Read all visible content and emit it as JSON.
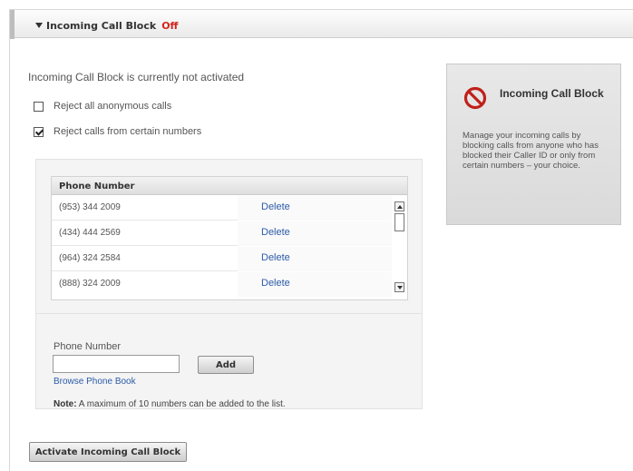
{
  "header": {
    "title": "Incoming Call Block",
    "status": "Off"
  },
  "status_text": "Incoming Call Block is currently not activated",
  "options": [
    {
      "label": "Reject all anonymous calls",
      "checked": false
    },
    {
      "label": "Reject calls from certain numbers",
      "checked": true
    }
  ],
  "table": {
    "column_header": "Phone Number",
    "rows": [
      {
        "number": "(953) 344 2009",
        "action": "Delete"
      },
      {
        "number": "(434) 444 2569",
        "action": "Delete"
      },
      {
        "number": "(964) 324 2584",
        "action": "Delete"
      },
      {
        "number": "(888) 324 2009",
        "action": "Delete"
      }
    ]
  },
  "add_form": {
    "label": "Phone Number",
    "value": "",
    "placeholder": "",
    "add_label": "Add",
    "browse_label": "Browse Phone Book",
    "note_label": "Note:",
    "note_text": "A maximum of 10 numbers can be added to the list."
  },
  "activate_label": "Activate Incoming Call Block",
  "info_box": {
    "icon": "block-icon",
    "title": "Incoming Call Block",
    "text": "Manage your incoming calls by blocking calls from anyone who has blocked their Caller ID or only from certain numbers – your choice."
  },
  "colors": {
    "status_off": "#d2241a",
    "link": "#2b5ba8",
    "block_icon": "#c0201a"
  }
}
